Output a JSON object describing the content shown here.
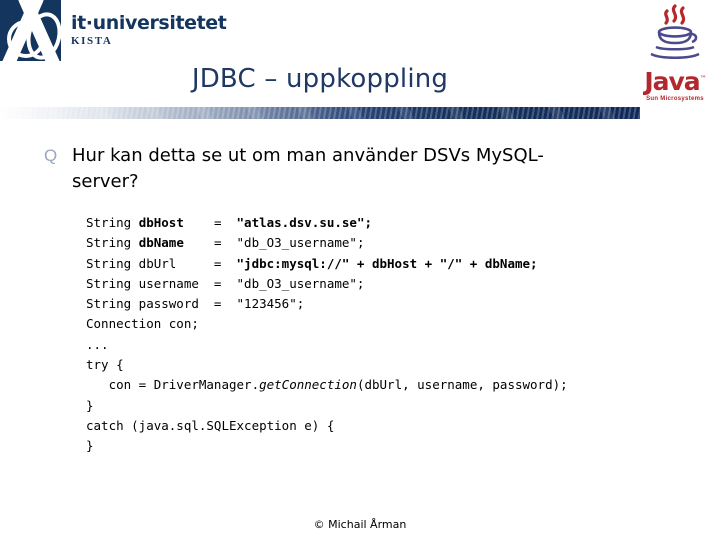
{
  "header": {
    "itu_logo": {
      "name": "it·universitetet",
      "subtitle": "KISTA"
    },
    "java_logo": {
      "word": "Java",
      "tm": "™",
      "sun": "Sun Microsystems"
    },
    "title": "JDBC – uppkoppling"
  },
  "body": {
    "bullet_glyph": "Q",
    "bullet_text": "Hur kan detta se ut om man använder DSVs MySQL-server?",
    "code_lines": [
      [
        {
          "t": "String ",
          "s": "normal"
        },
        {
          "t": "dbHost",
          "s": "bold"
        },
        {
          "t": "    =  ",
          "s": "normal"
        },
        {
          "t": "\"atlas.dsv.su.se\";",
          "s": "bold"
        }
      ],
      [
        {
          "t": "String ",
          "s": "normal"
        },
        {
          "t": "dbName",
          "s": "bold"
        },
        {
          "t": "    =  ",
          "s": "normal"
        },
        {
          "t": "\"db_O3_username\";",
          "s": "normal"
        }
      ],
      [
        {
          "t": "String dbUrl     =  ",
          "s": "normal"
        },
        {
          "t": "\"jdbc:mysql://\" + dbHost + \"/\" + dbName;",
          "s": "bold"
        }
      ],
      [
        {
          "t": "String username  =  \"db_O3_username\";",
          "s": "normal"
        }
      ],
      [
        {
          "t": "String password  =  \"123456\";",
          "s": "normal"
        }
      ],
      [
        {
          "t": "Connection con;",
          "s": "normal"
        }
      ],
      [
        {
          "t": "...",
          "s": "normal"
        }
      ],
      [
        {
          "t": "try {",
          "s": "normal"
        }
      ],
      [
        {
          "t": "   con = DriverManager.",
          "s": "normal"
        },
        {
          "t": "getConnection",
          "s": "italic"
        },
        {
          "t": "(dbUrl, username, password);",
          "s": "normal"
        }
      ],
      [
        {
          "t": "}",
          "s": "normal"
        }
      ],
      [
        {
          "t": "catch (java.sql.SQLException e) {",
          "s": "normal"
        }
      ],
      [
        {
          "t": "}",
          "s": "normal"
        }
      ]
    ]
  },
  "footer": {
    "copyright": "© Michail Årman"
  },
  "colors": {
    "navy": "#13355e",
    "title_navy": "#1f3864",
    "java_red": "#b4272c",
    "bullet_blue": "#9aa7bd"
  }
}
